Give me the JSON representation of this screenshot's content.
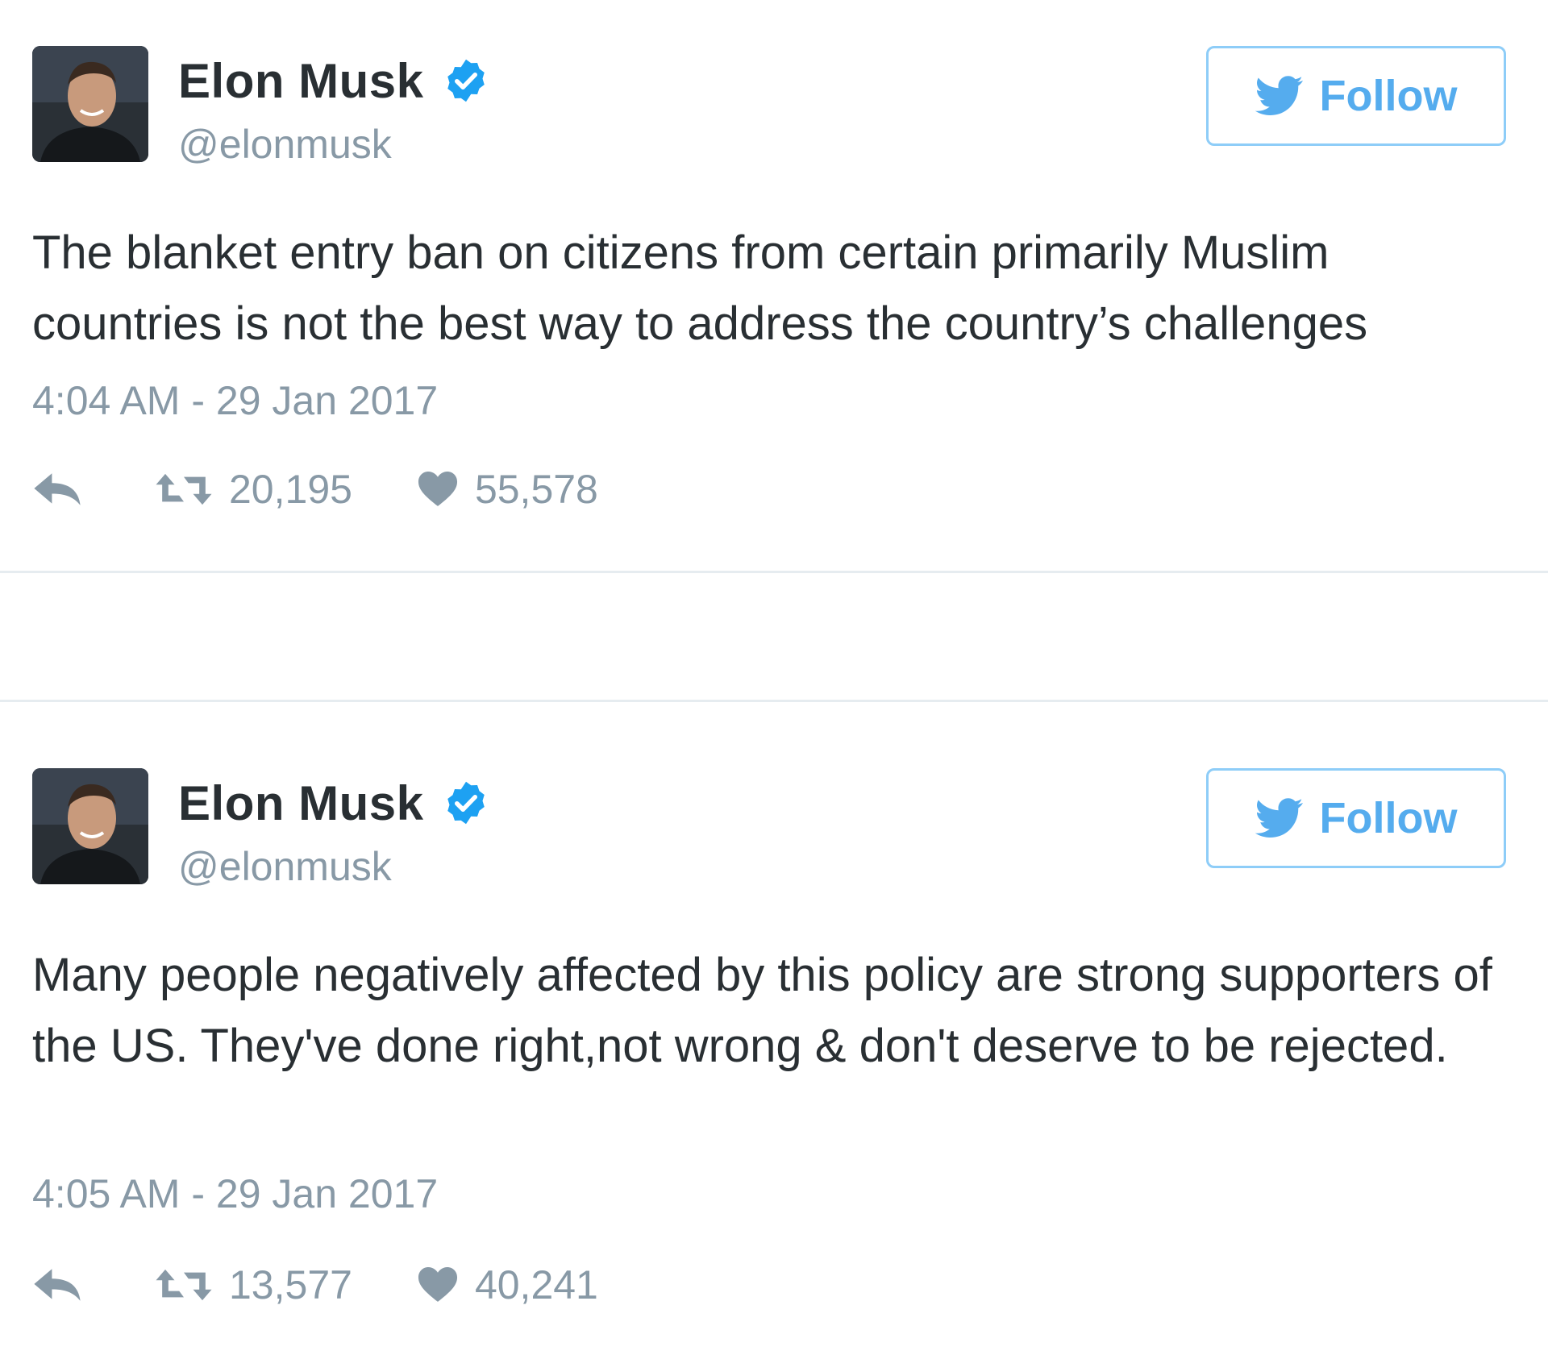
{
  "tweets": [
    {
      "author": {
        "display_name": "Elon Musk",
        "handle": "@elonmusk",
        "verified": true
      },
      "follow_label": "Follow",
      "text": "The blanket entry ban on citizens from certain primarily Muslim countries is not the best way to address the country’s challenges",
      "timestamp": "4:04 AM - 29 Jan 2017",
      "retweets": "20,195",
      "likes": "55,578"
    },
    {
      "author": {
        "display_name": "Elon Musk",
        "handle": "@elonmusk",
        "verified": true
      },
      "follow_label": "Follow",
      "text": "Many people negatively affected by this policy are strong supporters of the US. They've done right,not wrong & don't deserve to be rejected.",
      "timestamp": "4:05 AM - 29 Jan 2017",
      "retweets": "13,577",
      "likes": "40,241"
    }
  ],
  "icons": {
    "verified": "verified-badge-icon",
    "follow": "twitter-bird-icon",
    "reply": "reply-icon",
    "retweet": "retweet-icon",
    "like": "heart-icon"
  },
  "colors": {
    "text": "#292f33",
    "secondary_text": "#8899a6",
    "twitter_blue": "#55acee",
    "verified_blue": "#1da1f2",
    "button_border": "#8ecdf8",
    "divider": "#e6ecf0"
  }
}
